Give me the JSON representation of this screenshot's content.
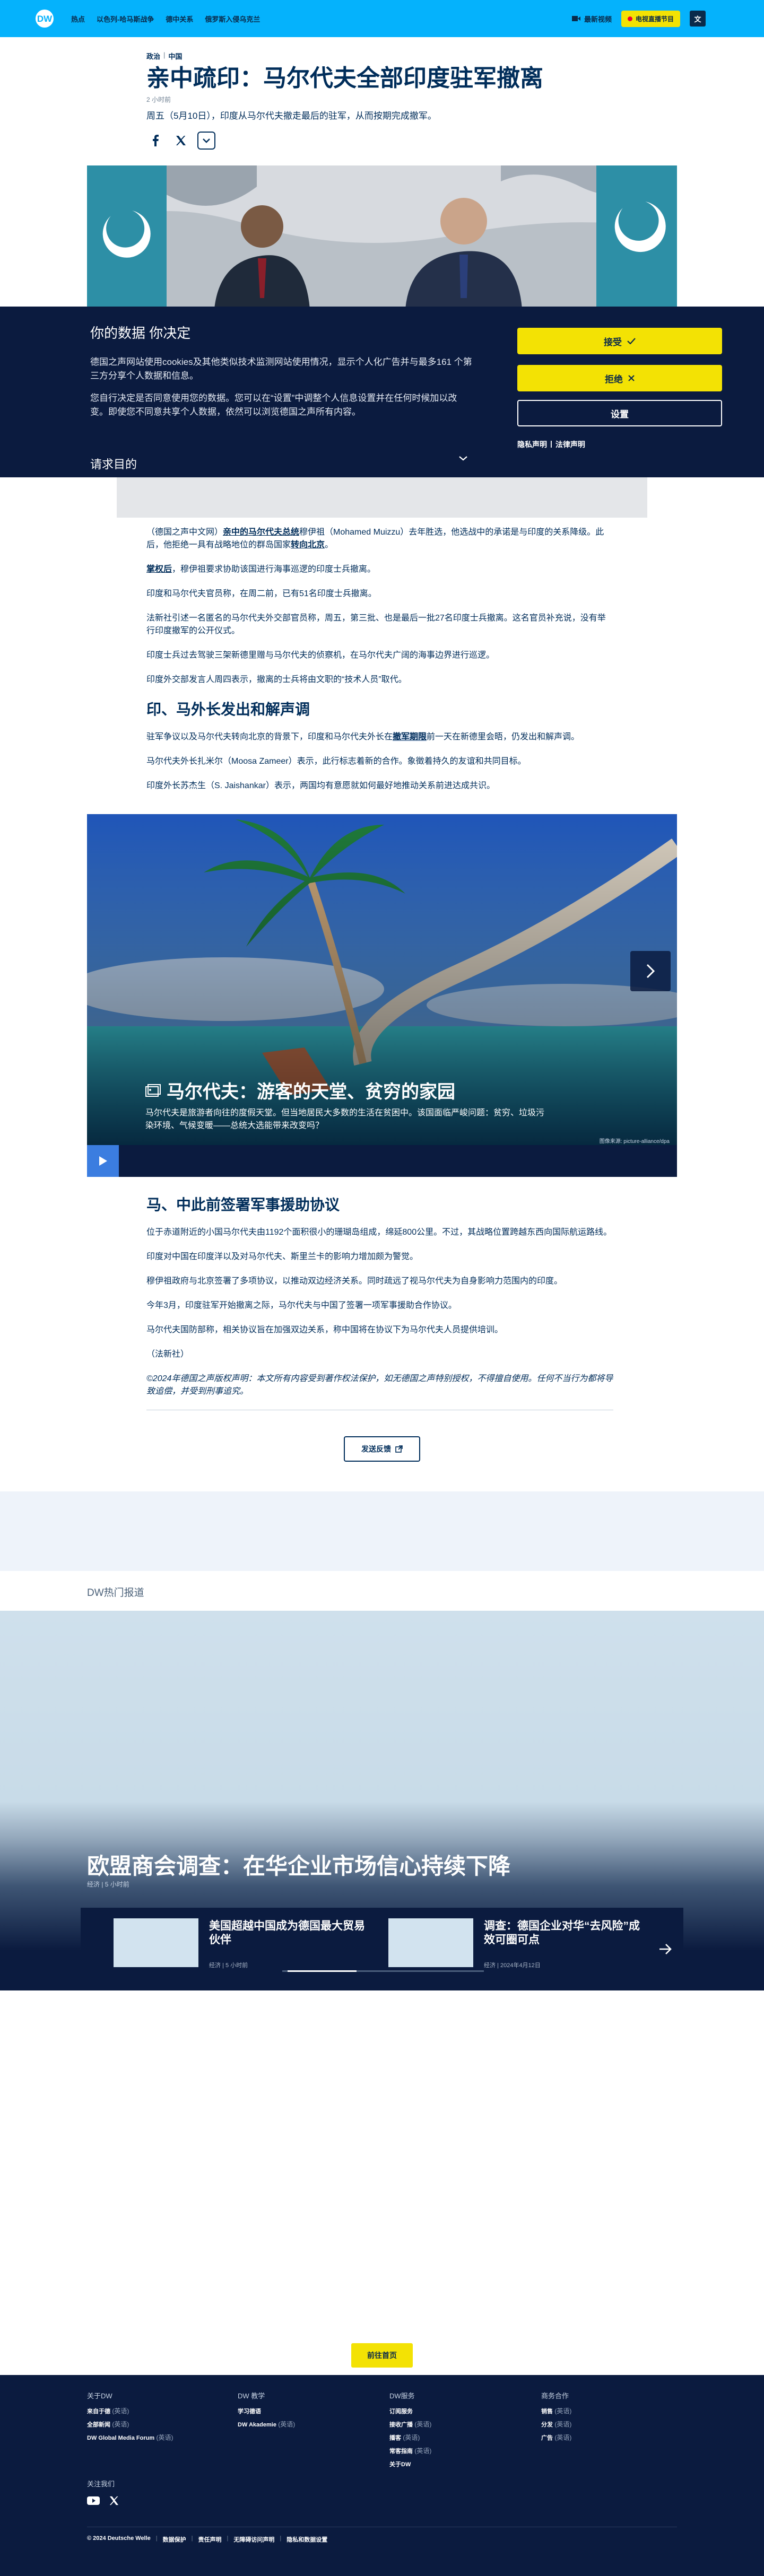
{
  "colors": {
    "header_bg": "#05b2fc",
    "navy": "#0b1b3f",
    "accent_yellow": "#f3e204",
    "text": "#002d5a"
  },
  "header": {
    "logo_text": "DW",
    "nav": [
      "热点",
      "以色列-哈马斯战争",
      "德中关系",
      "俄罗斯入侵乌克兰"
    ],
    "latest_videos": "最新视频",
    "live_tv": "电视直播节目",
    "language_button": "文"
  },
  "article": {
    "category": "政治",
    "region": "中国",
    "headline": "亲中疏印：马尔代夫全部印度驻军撤离",
    "time_ago": "2 小时前",
    "teaser": "周五（5月10日），印度从马尔代夫撤走最后的驻军，从而按期完成撤军。",
    "share_icons": [
      "facebook-icon",
      "x-icon",
      "chevron-down-icon"
    ]
  },
  "consent": {
    "title": "你的数据 你决定",
    "text1": "德国之声网站使用cookies及其他类似技术监测网站使用情况，显示个人化广告并与最多161 个第三方分享个人数据和信息。",
    "text2": "您自行决定是否同意使用您的数据。您可以在“设置”中调整个人信息设置并在任何时候加以改变。即使您不同意共享个人数据，依然可以浏览德国之声所有内容。",
    "accept": "接受",
    "reject": "拒绝",
    "settings": "设置",
    "privacy": "隐私声明",
    "legal": "法律声明",
    "more": "请求目的"
  },
  "body": {
    "p1_a": "（德国之声中文网）",
    "p1_link": "亲中的马尔代夫总统",
    "p1_b": "穆伊祖（Mohamed Muizzu）去年胜选，他选战中的承诺是与印度的关系降级。此后，他拒绝一具有战略地位的群岛国家",
    "p1_link2": "转向北京",
    "p1_c": "。",
    "p2_link": "掌权后",
    "p2_b": "，穆伊祖要求协助该国进行海事巡逻的印度士兵撤离。",
    "p3": "印度和马尔代夫官员称，在周二前，已有51名印度士兵撤离。",
    "p4": "法新社引述一名匿名的马尔代夫外交部官员称，周五，第三批、也是最后一批27名印度士兵撤离。这名官员补充说，没有举行印度撤军的公开仪式。",
    "p5": "印度士兵过去驾驶三架新德里赠与马尔代夫的侦察机，在马尔代夫广阔的海事边界进行巡逻。",
    "p6": "印度外交部发言人周四表示，撤离的士兵将由文职的“技术人员”取代。",
    "subhead1": "印、马外长发出和解声调",
    "p7_a": "驻军争议以及马尔代夫转向北京的背景下，印度和马尔代夫外长在",
    "p7_link": "撤军期限",
    "p7_b": "前一天在新德里会晤，仍发出和解声调。",
    "p8": "马尔代夫外长扎米尔（Moosa Zameer）表示，此行标志着新的合作。象徵着持久的友谊和共同目标。",
    "p9": "印度外长苏杰生（S. Jaishankar）表示，两国均有意愿就如何最好地推动关系前进达成共识。",
    "subhead2": "马、中此前签署军事援助协议",
    "p10": "位于赤道附近的小国马尔代夫由1192个面积很小的珊瑚岛组成，绵延800公里。不过，其战略位置跨越东西向国际航运路线。",
    "p11": "印度对中国在印度洋以及对马尔代夫、斯里兰卡的影响力增加颇为警觉。",
    "p12": "穆伊祖政府与北京签署了多项协议，以推动双边经济关系。同时疏远了视马尔代夫为自身影响力范围内的印度。",
    "p13": "今年3月，印度驻军开始撤离之际，马尔代夫与中国了签署一项军事援助合作协议。",
    "p14": "马尔代夫国防部称，相关协议旨在加强双边关系，称中国将在协议下为马尔代夫人员提供培训。",
    "p15": "（法新社）",
    "copyright": "©2024年德国之声版权声明：本文所有内容受到著作权法保护，如无德国之声特别授权，不得擅自使用。任何不当行为都将导致追偿，并受到刑事追究。",
    "feedback": "发送反馈"
  },
  "gallery": {
    "title": "马尔代夫：游客的天堂、贫穷的家园",
    "description": "马尔代夫是旅游者向往的度假天堂。但当地居民大多数的生活在贫困中。该国面临严峻问题：贫穷、垃圾污染环境、气候变暖——总统大选能带来改变吗？",
    "credit": "图像来源: picture-alliance/dpa"
  },
  "trending": {
    "section_title": "DW热门报道",
    "feature_title": "欧盟商会调查：在华企业市场信心持续下降",
    "feature_meta": "经济 | 5 小时前",
    "cards": [
      {
        "title": "美国超越中国成为德国最大贸易伙伴",
        "meta": "经济 | 5 小时前"
      },
      {
        "title": "调查：德国企业对华“去风险”成效可圈可点",
        "meta": "经济 | 2024年4月12日"
      }
    ]
  },
  "home_button": "前往首页",
  "footer": {
    "col1": {
      "title": "关于DW",
      "items": [
        {
          "label": "来自于德",
          "lang": "(英语)"
        },
        {
          "label": "全部新闻",
          "lang": "(英语)"
        },
        {
          "label": "DW Global Media Forum",
          "lang": "(英语)"
        }
      ]
    },
    "col2": {
      "title": "DW 教学",
      "items": [
        {
          "label": "学习德语",
          "lang": ""
        },
        {
          "label": "DW Akademie",
          "lang": "(英语)"
        }
      ]
    },
    "col3": {
      "title": "DW服务",
      "items": [
        {
          "label": "订阅服务",
          "lang": ""
        },
        {
          "label": "接收广播",
          "lang": "(英语)"
        },
        {
          "label": "播客",
          "lang": "(英语)"
        },
        {
          "label": "常客指南",
          "lang": "(英语)"
        },
        {
          "label": "关于DW",
          "lang": ""
        }
      ]
    },
    "col4": {
      "title": "商务合作",
      "items": [
        {
          "label": "销售",
          "lang": "(英语)"
        },
        {
          "label": "分发",
          "lang": "(英语)"
        },
        {
          "label": "广告",
          "lang": "(英语)"
        }
      ]
    },
    "follow": "关注我们",
    "legal": [
      "© 2024 Deutsche Welle",
      "数据保护",
      "责任声明",
      "无障碍访问声明",
      "隐私和数据设置"
    ]
  }
}
